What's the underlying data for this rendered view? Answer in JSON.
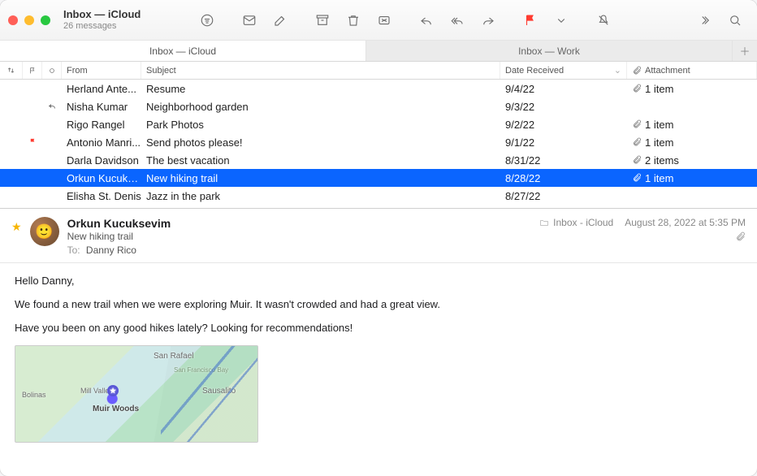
{
  "window": {
    "title": "Inbox — iCloud",
    "subtitle": "26 messages"
  },
  "tabs": [
    {
      "label": "Inbox — iCloud",
      "active": true
    },
    {
      "label": "Inbox — Work",
      "active": false
    }
  ],
  "columns": {
    "from": "From",
    "subject": "Subject",
    "date": "Date Received",
    "attachment": "Attachment"
  },
  "messages": [
    {
      "from": "Herland Ante...",
      "subject": "Resume",
      "date": "9/4/22",
      "attachment": "1 item",
      "flag": false,
      "replied": false
    },
    {
      "from": "Nisha Kumar",
      "subject": "Neighborhood garden",
      "date": "9/3/22",
      "attachment": "",
      "flag": false,
      "replied": true
    },
    {
      "from": "Rigo Rangel",
      "subject": "Park Photos",
      "date": "9/2/22",
      "attachment": "1 item",
      "flag": false,
      "replied": false
    },
    {
      "from": "Antonio Manri...",
      "subject": "Send photos please!",
      "date": "9/1/22",
      "attachment": "1 item",
      "flag": true,
      "replied": false
    },
    {
      "from": "Darla Davidson",
      "subject": "The best vacation",
      "date": "8/31/22",
      "attachment": "2 items",
      "flag": false,
      "replied": false
    },
    {
      "from": "Orkun Kucuks...",
      "subject": "New hiking trail",
      "date": "8/28/22",
      "attachment": "1 item",
      "flag": false,
      "replied": false,
      "selected": true
    },
    {
      "from": "Elisha St. Denis",
      "subject": "Jazz in the park",
      "date": "8/27/22",
      "attachment": "",
      "flag": false,
      "replied": false
    }
  ],
  "preview": {
    "sender": "Orkun Kucuksevim",
    "subject": "New hiking trail",
    "to_label": "To:",
    "to_value": "Danny Rico",
    "folder": "Inbox - iCloud",
    "datetime": "August 28, 2022 at 5:35 PM",
    "body": {
      "p1": "Hello Danny,",
      "p2": "We found a new trail when we were exploring Muir. It wasn't crowded and had a great view.",
      "p3": "Have you been on any good hikes lately? Looking for recommendations!"
    },
    "map": {
      "pin_label": "Muir Woods",
      "labels": {
        "san_rafael": "San Rafael",
        "sausalito": "Sausalito",
        "mill_valley": "Mill Valley",
        "bolinas": "Bolinas",
        "bay": "San Francisco Bay"
      }
    }
  },
  "chart_data": {
    "type": "table",
    "note": "no chart in image"
  }
}
